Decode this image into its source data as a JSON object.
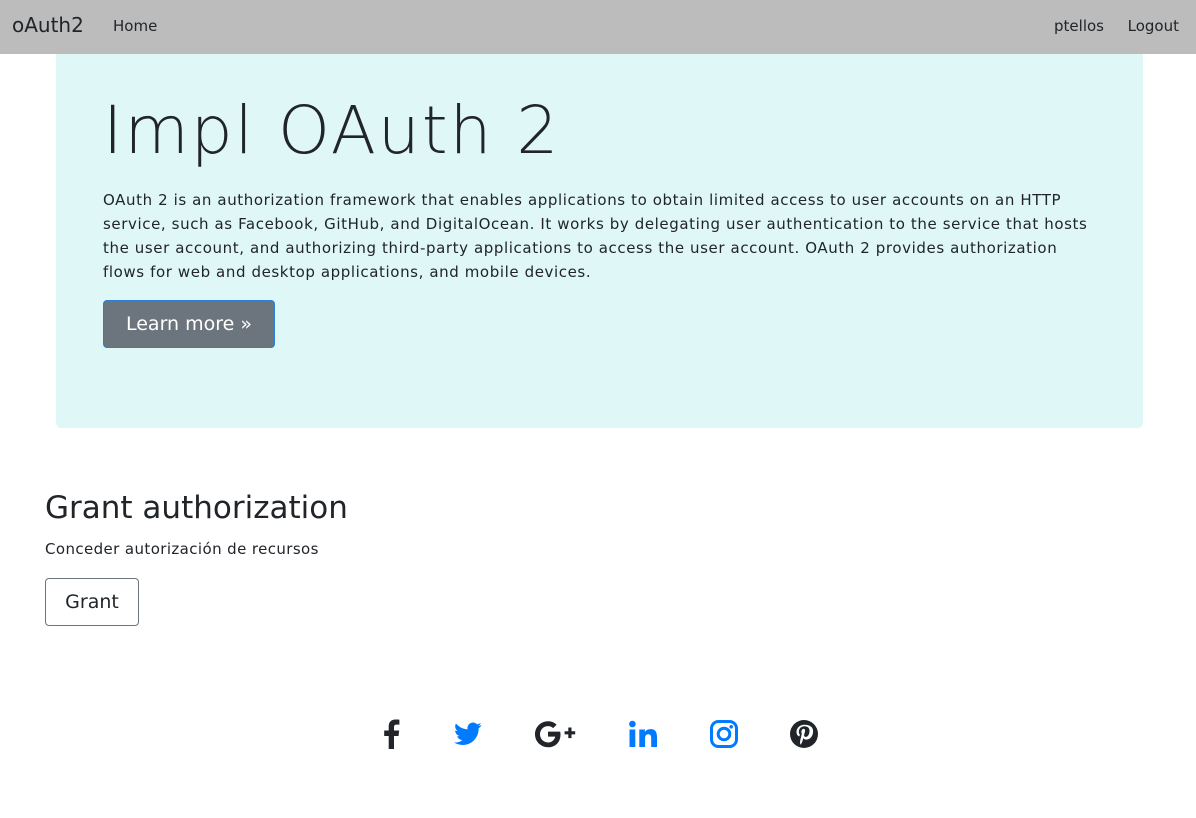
{
  "navbar": {
    "brand": "oAuth2",
    "home": "Home",
    "user": "ptellos",
    "logout": "Logout"
  },
  "hero": {
    "title": "Impl OAuth 2",
    "description": "OAuth 2 is an authorization framework that enables applications to obtain limited access to user accounts on an HTTP service, such as Facebook, GitHub, and DigitalOcean. It works by delegating user authentication to the service that hosts the user account, and authorizing third-party applications to access the user account. OAuth 2 provides authorization flows for web and desktop applications, and mobile devices.",
    "button": "Learn more »"
  },
  "grant": {
    "title": "Grant authorization",
    "description": "Conceder autorización de recursos",
    "button": "Grant"
  },
  "social": {
    "icons": [
      "facebook-icon",
      "twitter-icon",
      "google-plus-icon",
      "linkedin-icon",
      "instagram-icon",
      "pinterest-icon"
    ],
    "colors": {
      "dark": "#212529",
      "blue": "#007bff"
    }
  },
  "colors": {
    "navbar_bg": "#bcbcbc",
    "hero_bg": "#dff7f7",
    "learn_button_bg": "#6c757d"
  }
}
